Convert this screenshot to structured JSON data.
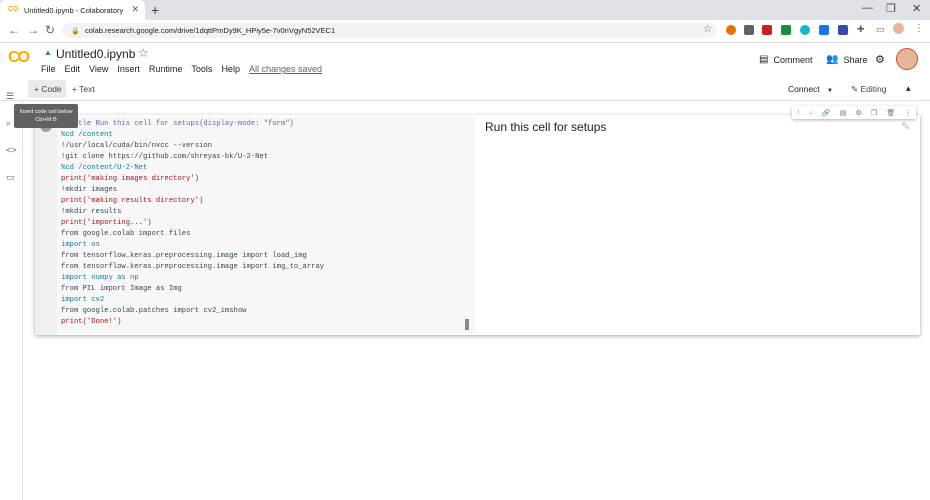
{
  "browser": {
    "tab_title": "Untitled0.ipynb - Colaboratory",
    "tab_favicon": "CO",
    "url": "colab.research.google.com/drive/1dqttPmDy9K_HPiy5e-7v0nVgyN52VEC1"
  },
  "header": {
    "logo": "CO",
    "notebook_title": "Untitled0.ipynb",
    "menu": [
      "File",
      "Edit",
      "View",
      "Insert",
      "Runtime",
      "Tools",
      "Help"
    ],
    "save_status": "All changes saved",
    "comment_label": "Comment",
    "share_label": "Share"
  },
  "toolbar": {
    "code_label": "+ Code",
    "text_label": "+ Text",
    "connect_label": "Connect",
    "editing_label": "Editing",
    "tooltip_line1": "Insert code cell below",
    "tooltip_line2": "Ctrl+M B"
  },
  "cell": {
    "form_title": "Run this cell for setups",
    "code_lines": [
      "#@title Run this cell for setups{display-mode: \"form\"}",
      "%cd /content",
      "!/usr/local/cuda/bin/nvcc --version",
      "!git clone https://github.com/shreyas-bk/U-2-Net",
      "%cd /content/U-2-Net",
      "print('making images directory')",
      "!mkdir images",
      "print('making results directory')",
      "!mkdir results",
      "print('importing...')",
      "from google.colab import files",
      "import os",
      "from tensorflow.keras.preprocessing.image import load_img",
      "from tensorflow.keras.preprocessing.image import img_to_array",
      "import numpy as np",
      "from PIL import Image as Img",
      "import cv2",
      "from google.colab.patches import cv2_imshow",
      "print('Done!')"
    ]
  },
  "colors": {
    "accent": "#f9ab00",
    "keyword": "#0b7c9b",
    "string": "#a31515"
  }
}
